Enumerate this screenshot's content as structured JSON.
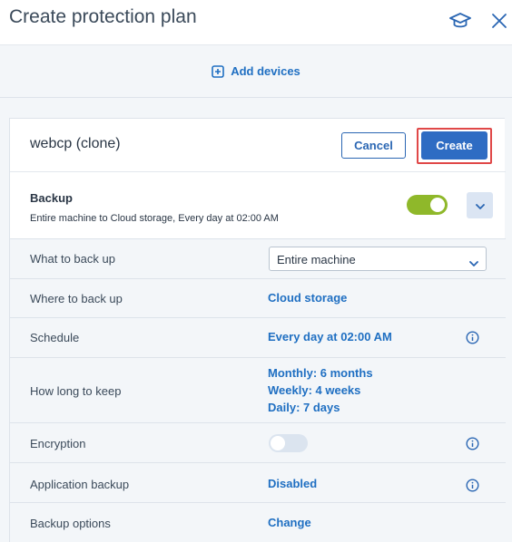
{
  "header": {
    "title": "Create protection plan"
  },
  "add_devices": {
    "label": "Add devices"
  },
  "plan": {
    "name": "webcp (clone)",
    "cancel_label": "Cancel",
    "create_label": "Create"
  },
  "backup": {
    "title": "Backup",
    "description": "Entire machine to Cloud storage, Every day at 02:00 AM",
    "enabled": true
  },
  "settings": {
    "what": {
      "label": "What to back up",
      "value": "Entire machine"
    },
    "where": {
      "label": "Where to back up",
      "value": "Cloud storage"
    },
    "schedule": {
      "label": "Schedule",
      "value": "Every day at 02:00 AM"
    },
    "keep": {
      "label": "How long to keep",
      "lines": [
        "Monthly: 6 months",
        "Weekly: 4 weeks",
        "Daily: 7 days"
      ]
    },
    "encryption": {
      "label": "Encryption",
      "enabled": false
    },
    "app_backup": {
      "label": "Application backup",
      "value": "Disabled"
    },
    "options": {
      "label": "Backup options",
      "value": "Change"
    }
  },
  "colors": {
    "accent": "#1f6fc2",
    "primary_button": "#2e6cc3",
    "toggle_on": "#8fb82a",
    "highlight": "#e04848"
  }
}
